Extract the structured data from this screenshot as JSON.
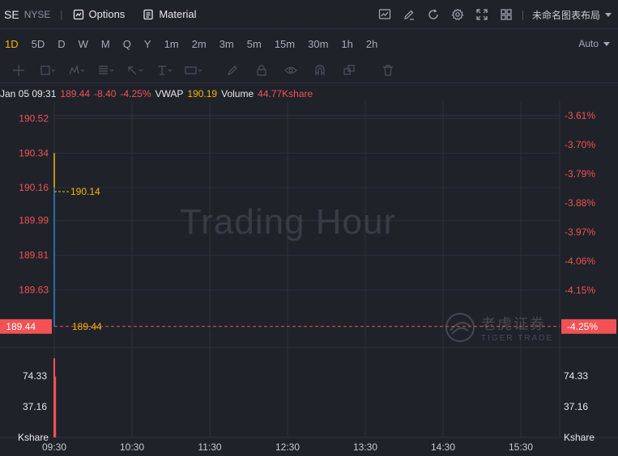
{
  "header": {
    "symbol": "SE",
    "exchange": "NYSE",
    "separator": "|",
    "options_label": "Options",
    "material_label": "Material",
    "layout_name": "未命名图表布局"
  },
  "periods": [
    "1D",
    "5D",
    "D",
    "W",
    "M",
    "Q",
    "Y",
    "1m",
    "2m",
    "3m",
    "5m",
    "15m",
    "30m",
    "1h",
    "2h"
  ],
  "active_period": "1D",
  "auto_label": "Auto",
  "info": {
    "datetime": "Jan 05 09:31",
    "price": "189.44",
    "change": "-8.40",
    "change_pct": "-4.25%",
    "vwap_label": "VWAP",
    "vwap": "190.19",
    "volume_label": "Volume",
    "volume": "44.77Kshare"
  },
  "watermark": "Trading Hour",
  "logo": {
    "cn": "老虎证券",
    "en": "TIGER TRADE"
  },
  "chart_data": {
    "type": "line",
    "price_axis": [
      "190.52",
      "190.34",
      "190.16",
      "189.99",
      "189.81",
      "189.63"
    ],
    "pct_axis": [
      "-3.61%",
      "-3.70%",
      "-3.79%",
      "-3.88%",
      "-3.97%",
      "-4.06%",
      "-4.15%"
    ],
    "current_price": "189.44",
    "current_pct": "-4.25%",
    "vwap_marker": "190.14",
    "price_marker": "189.44",
    "volume_axis": [
      "74.33",
      "37.16"
    ],
    "volume_unit": "Kshare",
    "time_axis": [
      "09:30",
      "10:30",
      "11:30",
      "12:30",
      "13:30",
      "14:30",
      "15:30"
    ],
    "price_range": [
      189.33,
      190.61
    ],
    "series": [
      {
        "values": [
          190.34,
          190.16,
          189.44
        ]
      }
    ],
    "volume_max": 100,
    "volume_bars": [
      {
        "time": "09:30",
        "value": 96
      },
      {
        "time": "09:31",
        "value": 74
      }
    ],
    "colors": {
      "up": "#f25255",
      "price_line": "#2f86d6",
      "vwap": "#f5b700",
      "grid": "#2d3139"
    }
  }
}
